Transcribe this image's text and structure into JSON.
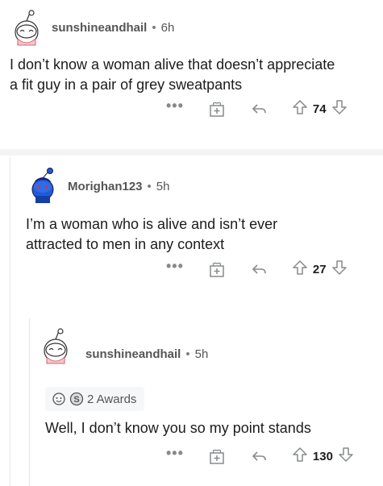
{
  "comments": [
    {
      "author": "sunshineandhail",
      "separator": "•",
      "age": "6h",
      "body_line1": "I don’t know a woman alive that doesn’t appreciate",
      "body_line2": "a fit guy in a pair of grey sweatpants",
      "more": "•••",
      "votes": "74",
      "avatar_icon": "snoo-avatar-icon"
    },
    {
      "author": "Morighan123",
      "separator": "•",
      "age": "5h",
      "body_line1": "I’m a woman who is alive and isn’t ever",
      "body_line2": "attracted to men in any context",
      "more": "•••",
      "votes": "27",
      "avatar_icon": "snoo-blue-avatar-icon"
    },
    {
      "author": "sunshineandhail",
      "separator": "•",
      "age": "5h",
      "awards_label": "2 Awards",
      "body_line1": "Well, I don’t know you so my point stands",
      "more": "•••",
      "votes": "130",
      "avatar_icon": "snoo-avatar-icon"
    }
  ]
}
